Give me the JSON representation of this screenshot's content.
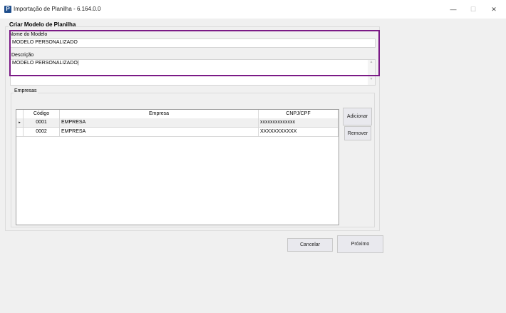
{
  "window": {
    "title": "Importação de Planilha - 6.164.0.0",
    "icon": "P",
    "controls": {
      "minimize": "—",
      "maximize": "☐",
      "close": "✕"
    }
  },
  "form": {
    "group_title": "Criar Modelo de Planilha",
    "nome_label": "Nome do Modelo",
    "nome_value": "MODELO PERSONALIZADO",
    "descricao_label": "Descrição",
    "descricao_value": "MODELO PERSONALIZADO"
  },
  "empresas": {
    "group_title": "Empresas",
    "columns": [
      "Código",
      "Empresa",
      "CNPJ/CPF"
    ],
    "rows": [
      {
        "indicator": "▸",
        "codigo": "0001",
        "empresa": "EMPRESA",
        "cnpj": "xxxxxxxxxxxxxx"
      },
      {
        "indicator": "",
        "codigo": "0002",
        "empresa": "EMPRESA",
        "cnpj": "XXXXXXXXXXX"
      }
    ],
    "add_label": "Adicionar",
    "remove_label": "Remover"
  },
  "footer": {
    "cancel_label": "Cancelar",
    "next_label": "Próximo"
  },
  "colors": {
    "highlight": "#7b1a86"
  }
}
